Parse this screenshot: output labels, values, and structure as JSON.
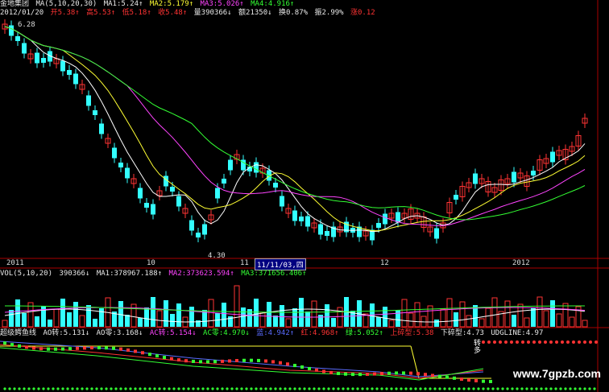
{
  "header": {
    "stock_name": "金地集团",
    "ma_label": "MA(5,10,20,30)",
    "ma1": "MA1:5.24↑",
    "ma2": "MA2:5.179↑",
    "ma3": "MA3:5.026↑",
    "ma4": "MA4:4.916↑"
  },
  "quote": {
    "date": "2012/01/20",
    "open": "开5.38↑",
    "high": "高5.53↑",
    "low": "低5.18↑",
    "close": "收5.48↑",
    "volume": "量390366↓",
    "amount": "额21350↓",
    "turnover": "换0.87%",
    "amplitude": "振2.99%",
    "rise": "涨0.12"
  },
  "price_labels": {
    "high": "6.28",
    "low": "4.30"
  },
  "date_axis": {
    "labels": [
      "2011",
      "10",
      "11",
      "12",
      "2012"
    ],
    "cursor_date": "11/11/03,四"
  },
  "vol_header": {
    "label": "VOL(5,10,20)",
    "vol": "390366↓",
    "ma1": "MA1:378967.188↑",
    "ma2": "MA2:373623.594↑",
    "ma3": "MA3:371656.406↑"
  },
  "indicator_header": {
    "name": "超级鳄鱼线",
    "ao_zhuan": "AO转:5.131↓",
    "ao_ling": "AO零:3.168↓",
    "ac_zhuan": "AC转:5.154↓",
    "ac_ling": "AC零:4.970↓",
    "lan": "蓝:4.942↑",
    "hong": "红:4.968↑",
    "lv": "绿:5.052↑",
    "shang_sui": "上碎型:5.38",
    "xia_sui": "下碎型:4.73",
    "udgline": "UDGLINE:4.97"
  },
  "zhuanduo": "转多",
  "watermark": "www.7gpzb.com",
  "colors": {
    "up": "#ff3333",
    "down": "#33ffff",
    "ma1": "#ffffff",
    "ma2": "#ffff33",
    "ma3": "#ff44ff",
    "ma4": "#33ff33"
  }
}
